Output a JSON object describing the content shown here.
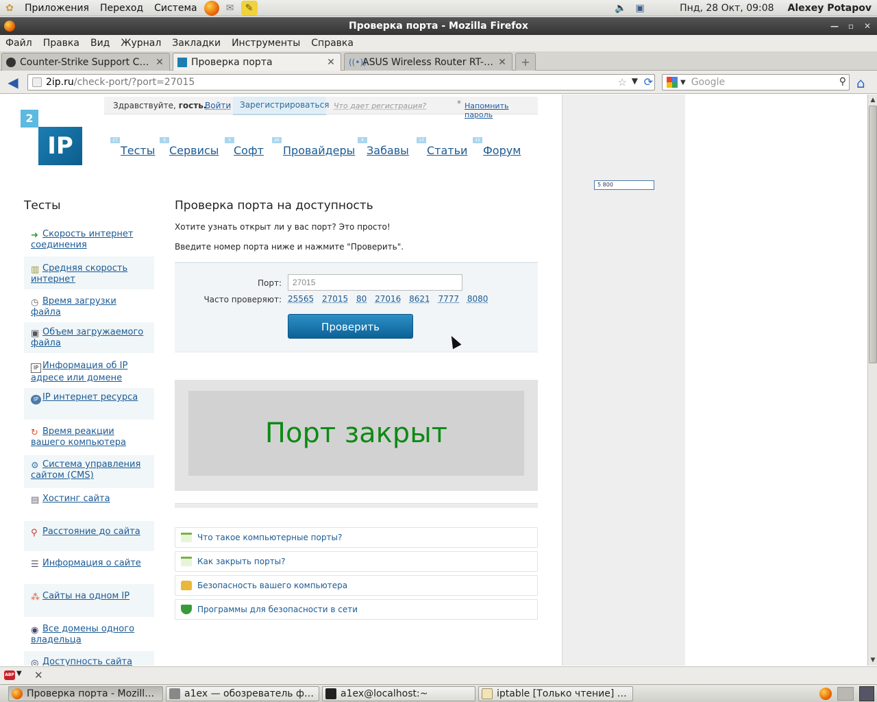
{
  "top_panel": {
    "menus": [
      "Приложения",
      "Переход",
      "Система"
    ],
    "launchers": [
      "firefox-icon",
      "mail-icon",
      "notes-icon"
    ],
    "clock": "Пнд, 28 Окт, 09:08",
    "user": "Alexey Potapov"
  },
  "window": {
    "title": "Проверка порта - Mozilla Firefox"
  },
  "menubar": [
    "Файл",
    "Правка",
    "Вид",
    "Журнал",
    "Закладки",
    "Инструменты",
    "Справка"
  ],
  "tabs": [
    {
      "label": "Counter-Strike Support Com...",
      "active": false
    },
    {
      "label": "Проверка порта",
      "active": true
    },
    {
      "label": "ASUS Wireless Router RT-N1...",
      "active": false
    }
  ],
  "navbar": {
    "url_host": "2ip.ru",
    "url_path": "/check-port/?port=27015",
    "search_placeholder": "Google"
  },
  "site": {
    "greeting_prefix": "Здравствуйте, ",
    "greeting_user": "гость.",
    "login": "Войти",
    "register": "Зарегистрироваться",
    "why_register": "Что дает регистрация?",
    "remind_password": "Напомнить пароль",
    "logo_small": "2",
    "logo_big": "IP",
    "nav": [
      {
        "label": "Тесты",
        "badge": "27"
      },
      {
        "label": "Сервисы",
        "badge": "9"
      },
      {
        "label": "Софт",
        "badge": "5"
      },
      {
        "label": "Провайдеры",
        "badge": "2K"
      },
      {
        "label": "Забавы",
        "badge": "4"
      },
      {
        "label": "Статьи",
        "badge": "13"
      },
      {
        "label": "Форум",
        "badge": "15"
      }
    ],
    "ad_label": "5 800"
  },
  "sidebar": {
    "title": "Тесты",
    "items": [
      {
        "label": "Скорость интернет соединения",
        "icon": "speed-arrow-icon"
      },
      {
        "label": "Средняя скорость интернет",
        "icon": "bars-icon"
      },
      {
        "label": "Время загрузки файла",
        "icon": "clock-icon"
      },
      {
        "label": "Объем загружаемого файла",
        "icon": "file-size-icon"
      },
      {
        "label": "Информация об IP адресе или домене",
        "icon": "ip-info-icon"
      },
      {
        "label": "IP интернет ресурса",
        "icon": "ip-resource-icon"
      },
      {
        "label": "Время реакции вашего компьютера",
        "icon": "reaction-icon"
      },
      {
        "label": "Система управления сайтом (CMS)",
        "icon": "cms-icon"
      },
      {
        "label": "Хостинг сайта",
        "icon": "hosting-icon"
      },
      {
        "label": "Расстояние до сайта",
        "icon": "map-pin-icon"
      },
      {
        "label": "Информация о сайте",
        "icon": "site-info-icon"
      },
      {
        "label": "Сайты на одном IP",
        "icon": "sites-ip-icon"
      },
      {
        "label": "Все домены одного владельца",
        "icon": "domains-icon"
      },
      {
        "label": "Доступность сайта",
        "icon": "availability-icon"
      }
    ]
  },
  "main": {
    "title": "Проверка порта на доступность",
    "intro1": "Хотите узнать открыт ли у вас порт? Это просто!",
    "intro2": "Введите номер порта ниже и нажмите \"Проверить\".",
    "port_label": "Порт:",
    "port_value": "27015",
    "frequent_label": "Часто проверяют:",
    "frequent_ports": [
      "25565",
      "27015",
      "80",
      "27016",
      "8621",
      "7777",
      "8080"
    ],
    "check_button": "Проверить",
    "result": "Порт закрыт",
    "faq": [
      {
        "label": "Что такое компьютерные порты?",
        "icon": "document-icon"
      },
      {
        "label": "Как закрыть порты?",
        "icon": "document-icon"
      },
      {
        "label": "Безопасность вашего компьютера",
        "icon": "lock-icon"
      },
      {
        "label": "Программы для безопасности в сети",
        "icon": "shield-icon"
      }
    ]
  },
  "taskbar": [
    {
      "label": "Проверка порта - Mozilla ...",
      "active": true
    },
    {
      "label": "a1ex — обозреватель фа...",
      "active": false
    },
    {
      "label": "a1ex@localhost:~",
      "active": false
    },
    {
      "label": "iptable [Только чтение] (/...",
      "active": false
    }
  ],
  "colors": {
    "link": "#1a5a94",
    "result_text": "#0d8a14",
    "button": "#0c6197"
  }
}
